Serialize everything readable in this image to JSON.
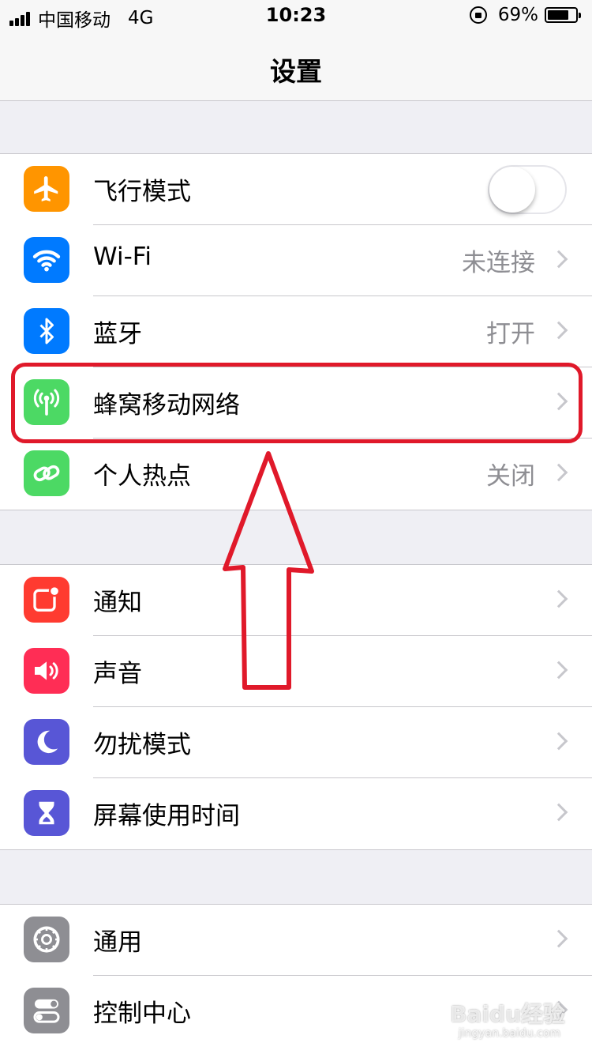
{
  "status_bar": {
    "carrier": "中国移动",
    "network": "4G",
    "time": "10:23",
    "battery_percent": "69%"
  },
  "nav": {
    "title": "设置"
  },
  "groups": [
    {
      "rows": [
        {
          "label": "飞行模式",
          "icon": "airplane-icon",
          "color": "#ff9500",
          "control": "toggle",
          "toggle_on": false
        },
        {
          "label": "Wi-Fi",
          "icon": "wifi-icon",
          "color": "#007aff",
          "value": "未连接"
        },
        {
          "label": "蓝牙",
          "icon": "bluetooth-icon",
          "color": "#007aff",
          "value": "打开"
        },
        {
          "label": "蜂窝移动网络",
          "icon": "cellular-antenna-icon",
          "color": "#4cd964"
        },
        {
          "label": "个人热点",
          "icon": "hotspot-link-icon",
          "color": "#4cd964",
          "value": "关闭"
        }
      ]
    },
    {
      "rows": [
        {
          "label": "通知",
          "icon": "notification-icon",
          "color": "#ff3b30"
        },
        {
          "label": "声音",
          "icon": "speaker-icon",
          "color": "#ff2d55"
        },
        {
          "label": "勿扰模式",
          "icon": "moon-icon",
          "color": "#5856d6"
        },
        {
          "label": "屏幕使用时间",
          "icon": "hourglass-icon",
          "color": "#5856d6"
        }
      ]
    },
    {
      "rows": [
        {
          "label": "通用",
          "icon": "gear-icon",
          "color": "#8e8e93"
        },
        {
          "label": "控制中心",
          "icon": "toggles-icon",
          "color": "#8e8e93"
        }
      ]
    }
  ],
  "annotation": {
    "color": "#e0192a"
  },
  "watermark": {
    "text": "Baidu经验",
    "sub": "jingyan.baidu.com"
  }
}
